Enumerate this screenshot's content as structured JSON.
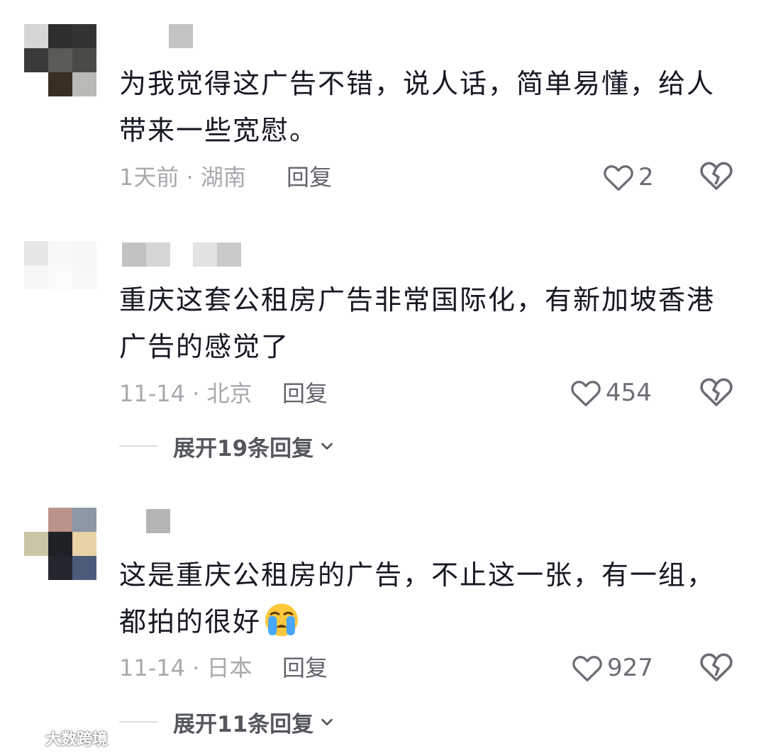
{
  "comments": [
    {
      "text": "为我觉得这广告不错，说人话，简单易懂，给人带来一些宽慰。",
      "date": "1天前",
      "location": "湖南",
      "reply_label": "回复",
      "likes": "2"
    },
    {
      "text": "重庆这套公租房广告非常国际化，有新加坡香港广告的感觉了",
      "date": "11-14",
      "location": "北京",
      "reply_label": "回复",
      "likes": "454",
      "expand_label": "展开19条回复"
    },
    {
      "text": "这是重庆公租房的广告，不止这一张，有一组，都拍的很好",
      "date": "11-14",
      "location": "日本",
      "reply_label": "回复",
      "likes": "927",
      "expand_label": "展开11条回复"
    }
  ],
  "separator": "·",
  "watermark": "大数跨境",
  "icons": {
    "like": "heart-outline-icon",
    "dislike": "broken-heart-icon",
    "expand": "chevron-down-icon",
    "emoji": "crying-face-emoji-icon"
  },
  "colors": {
    "text": "#161823",
    "meta": "#a7a9ad",
    "reply": "#62646c",
    "icon": "#6b6d74"
  }
}
